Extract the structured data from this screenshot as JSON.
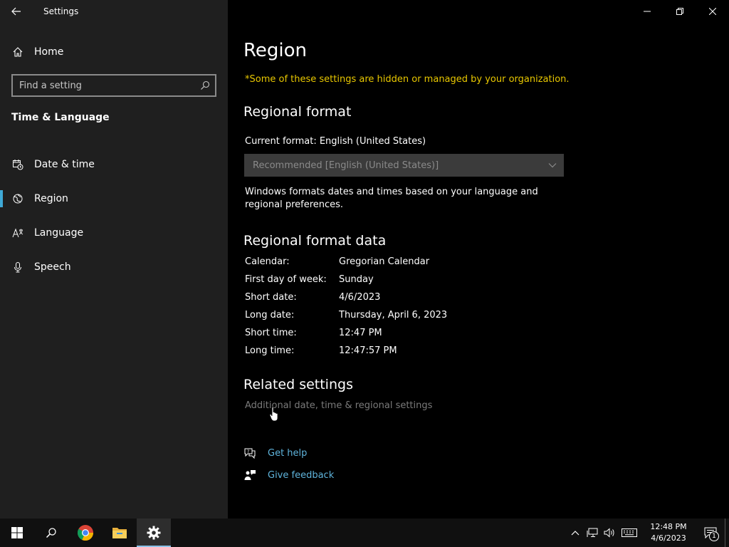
{
  "window": {
    "title": "Settings"
  },
  "sidebar": {
    "home_label": "Home",
    "search_placeholder": "Find a setting",
    "section_title": "Time & Language",
    "items": [
      {
        "label": "Date & time",
        "icon": "calendar-clock-icon",
        "active": false
      },
      {
        "label": "Region",
        "icon": "globe-icon",
        "active": true
      },
      {
        "label": "Language",
        "icon": "language-icon",
        "active": false
      },
      {
        "label": "Speech",
        "icon": "microphone-icon",
        "active": false
      }
    ]
  },
  "main": {
    "title": "Region",
    "org_note": "*Some of these settings are hidden or managed by your organization.",
    "regional_format": {
      "heading": "Regional format",
      "current_format": "Current format: English (United States)",
      "dropdown_value": "Recommended [English (United States)]",
      "description": "Windows formats dates and times based on your language and regional preferences."
    },
    "format_data": {
      "heading": "Regional format data",
      "rows": [
        {
          "key": "Calendar:",
          "value": "Gregorian Calendar"
        },
        {
          "key": "First day of week:",
          "value": "Sunday"
        },
        {
          "key": "Short date:",
          "value": "4/6/2023"
        },
        {
          "key": "Long date:",
          "value": "Thursday, April 6, 2023"
        },
        {
          "key": "Short time:",
          "value": "12:47 PM"
        },
        {
          "key": "Long time:",
          "value": "12:47:57 PM"
        }
      ]
    },
    "related": {
      "heading": "Related settings",
      "link": "Additional date, time & regional settings"
    },
    "help": {
      "get_help": "Get help",
      "give_feedback": "Give feedback"
    }
  },
  "taskbar": {
    "clock_time": "12:48 PM",
    "clock_date": "4/6/2023",
    "notification_count": "1"
  },
  "colors": {
    "accent": "#3fa9d6",
    "link": "#5fb4dc",
    "warning": "#e8c700",
    "sidebar_bg": "#1f1f1f",
    "content_bg": "#000000"
  }
}
